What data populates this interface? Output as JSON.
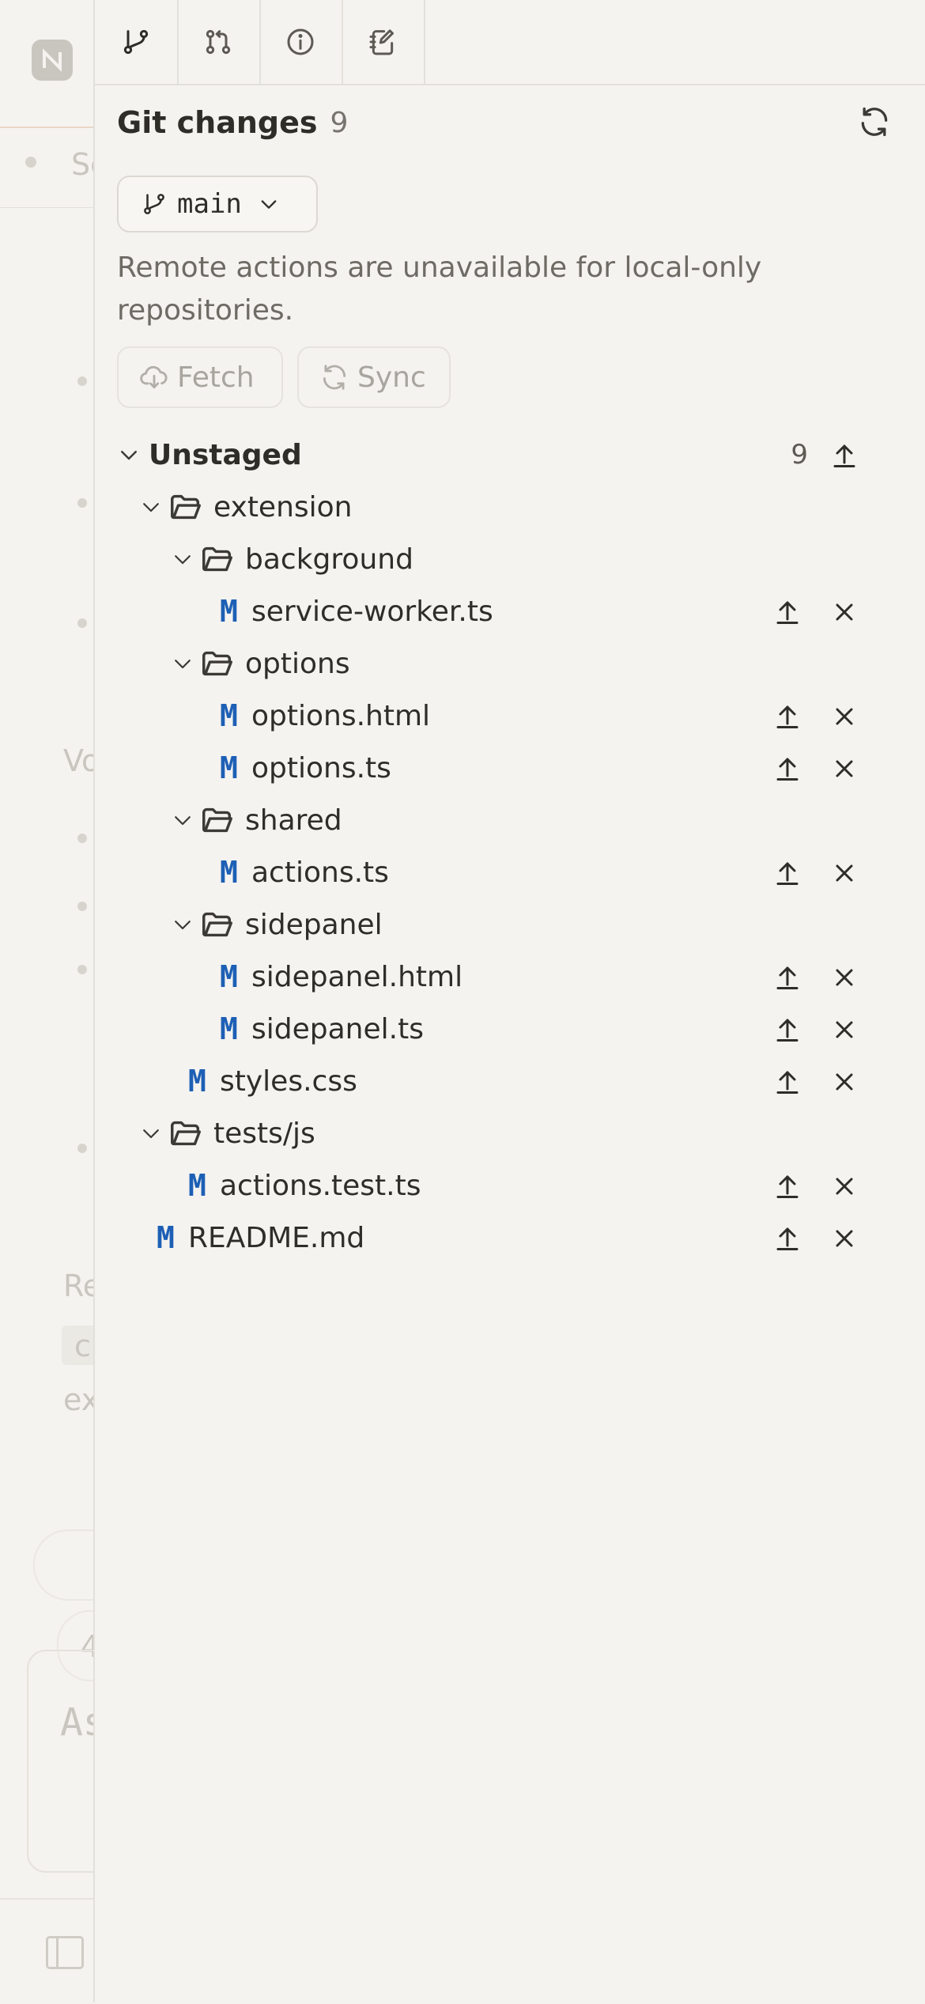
{
  "tabs": [
    {
      "icon": "git-branch-icon"
    },
    {
      "icon": "git-pull-request-icon"
    },
    {
      "icon": "info-icon"
    },
    {
      "icon": "notebook-edit-icon"
    }
  ],
  "header": {
    "title": "Git changes",
    "count": "9"
  },
  "branch": {
    "name": "main"
  },
  "notice": "Remote actions are unavailable for local-only repositories.",
  "buttons": {
    "fetch": "Fetch",
    "sync": "Sync"
  },
  "section": {
    "label": "Unstaged",
    "count": "9"
  },
  "tree": [
    {
      "type": "folder",
      "name": "extension",
      "depth": 1
    },
    {
      "type": "folder",
      "name": "background",
      "depth": 2
    },
    {
      "type": "file",
      "name": "service-worker.ts",
      "status": "M",
      "depth": 3
    },
    {
      "type": "folder",
      "name": "options",
      "depth": 2
    },
    {
      "type": "file",
      "name": "options.html",
      "status": "M",
      "depth": 3
    },
    {
      "type": "file",
      "name": "options.ts",
      "status": "M",
      "depth": 3
    },
    {
      "type": "folder",
      "name": "shared",
      "depth": 2
    },
    {
      "type": "file",
      "name": "actions.ts",
      "status": "M",
      "depth": 3
    },
    {
      "type": "folder",
      "name": "sidepanel",
      "depth": 2
    },
    {
      "type": "file",
      "name": "sidepanel.html",
      "status": "M",
      "depth": 3
    },
    {
      "type": "file",
      "name": "sidepanel.ts",
      "status": "M",
      "depth": 3
    },
    {
      "type": "file",
      "name": "styles.css",
      "status": "M",
      "depth": 2
    },
    {
      "type": "folder",
      "name": "tests/js",
      "depth": 1
    },
    {
      "type": "file",
      "name": "actions.test.ts",
      "status": "M",
      "depth": 2
    },
    {
      "type": "file",
      "name": "README.md",
      "status": "M",
      "depth": 1
    }
  ],
  "background": {
    "fragments": [
      "Se",
      "Vo",
      "Re",
      "c",
      "ex",
      "4",
      "As"
    ]
  },
  "colors": {
    "modified": "#1d5fb5",
    "accent": "#e08870"
  }
}
